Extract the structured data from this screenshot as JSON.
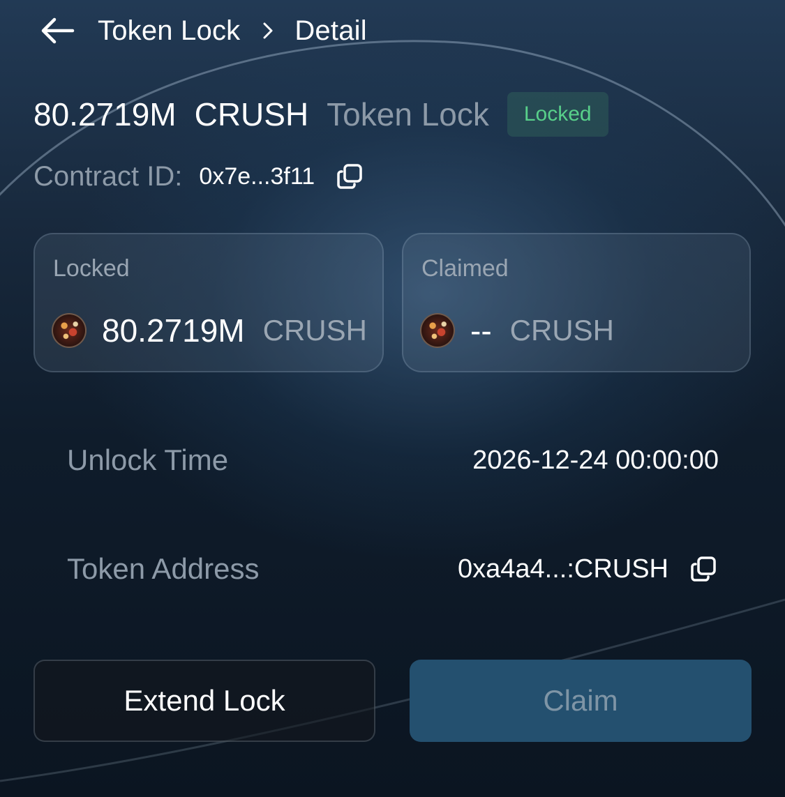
{
  "header": {
    "back_icon": "arrow-left-icon",
    "breadcrumb": [
      "Token Lock",
      "Detail"
    ],
    "separator_icon": "chevron-right-icon"
  },
  "title": {
    "amount": "80.2719M",
    "token": "CRUSH",
    "label": "Token Lock",
    "status": "Locked",
    "status_color": "#58d08a"
  },
  "contract": {
    "label": "Contract ID:",
    "value": "0x7e...3f11",
    "copy_icon": "copy-icon"
  },
  "cards": {
    "locked": {
      "label": "Locked",
      "amount": "80.2719M",
      "token": "CRUSH"
    },
    "claimed": {
      "label": "Claimed",
      "amount": "--",
      "token": "CRUSH"
    }
  },
  "details": {
    "unlock_time": {
      "label": "Unlock Time",
      "value": "2026-12-24 00:00:00"
    },
    "token_address": {
      "label": "Token Address",
      "value": "0xa4a4...:CRUSH",
      "copy_icon": "copy-icon"
    }
  },
  "actions": {
    "extend_label": "Extend Lock",
    "claim_label": "Claim",
    "claim_color": "#24506f"
  }
}
